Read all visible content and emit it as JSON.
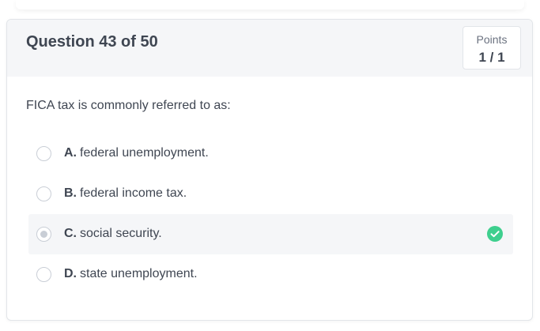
{
  "question": {
    "title": "Question 43 of 50",
    "points_label": "Points",
    "points_value": "1 / 1",
    "prompt": "FICA tax is commonly referred to as:"
  },
  "options": [
    {
      "letter": "A.",
      "text": "federal unemployment.",
      "selected": false
    },
    {
      "letter": "B.",
      "text": "federal income tax.",
      "selected": false
    },
    {
      "letter": "C.",
      "text": "social security.",
      "selected": true,
      "status_icon": "check-circle-icon"
    },
    {
      "letter": "D.",
      "text": "state unemployment.",
      "selected": false
    }
  ],
  "colors": {
    "correct": "#3ecf8e",
    "header_bg": "#f5f6f8",
    "text": "#3f4652"
  }
}
